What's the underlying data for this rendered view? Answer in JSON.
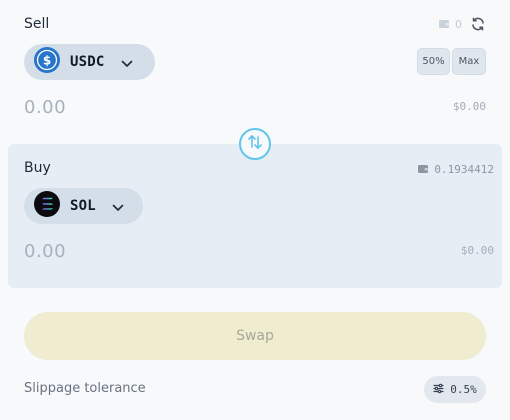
{
  "sell": {
    "title": "Sell",
    "balance": "0",
    "token": {
      "symbol": "USDC",
      "icon": "usdc-icon"
    },
    "pct_half_label": "50%",
    "pct_max_label": "Max",
    "amount": "0.00",
    "usd_value": "$0.00"
  },
  "buy": {
    "title": "Buy",
    "balance": "0.1934412",
    "token": {
      "symbol": "SOL",
      "icon": "sol-icon"
    },
    "amount": "0.00",
    "usd_value": "$0.00"
  },
  "swap": {
    "label": "Swap"
  },
  "slippage": {
    "label": "Slippage tolerance",
    "value": "0.5%"
  },
  "colors": {
    "accent": "#5fc5ea",
    "swap_disabled_bg": "#f0ecd0",
    "buy_panel_bg": "#e7edf4",
    "token_pill_bg": "#d4dee8",
    "usdc_blue": "#2775ca"
  }
}
